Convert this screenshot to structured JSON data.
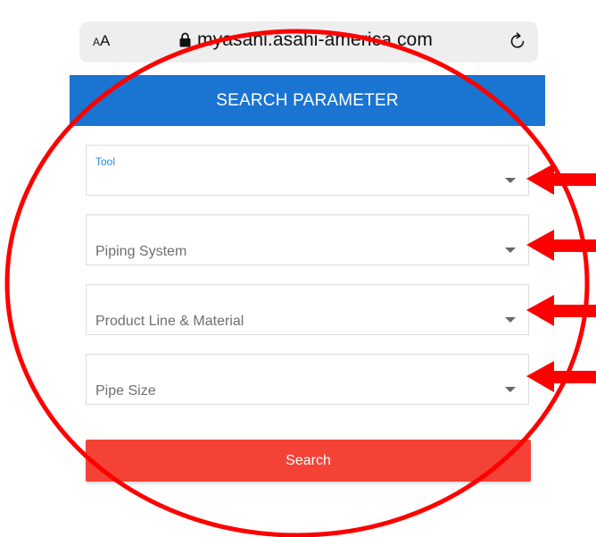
{
  "browser": {
    "text_size_small": "A",
    "text_size_large": "A",
    "domain": "myasahi.asahi-america.com",
    "lock_icon": "lock-icon",
    "reload_icon": "reload-icon"
  },
  "header": {
    "title": "SEARCH PARAMETER",
    "color": "#1a74d2"
  },
  "fields": [
    {
      "label": "Tool",
      "placeholder": ""
    },
    {
      "label": "",
      "placeholder": "Piping System"
    },
    {
      "label": "",
      "placeholder": "Product Line & Material"
    },
    {
      "label": "",
      "placeholder": "Pipe Size"
    }
  ],
  "search_button": {
    "label": "Search",
    "color": "#f44336"
  },
  "annotation": {
    "color": "#ff0000"
  }
}
